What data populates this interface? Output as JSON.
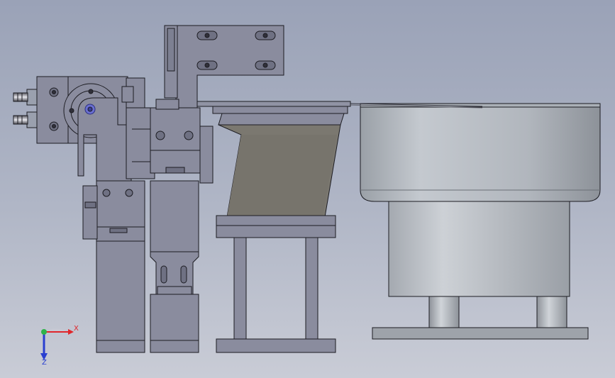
{
  "triad": {
    "x_label": "X",
    "z_label": "Z",
    "x_color": "#e0262b",
    "y_color": "#2fb34a",
    "z_color": "#2a3fd0"
  },
  "colors": {
    "background_top": "#9aa2b7",
    "background_bottom": "#c9ccd6",
    "steel": "#8a8c9e",
    "steel_dark": "#6f7183",
    "outline": "#1c1c22",
    "chute": "#7b7870",
    "bowl_light": "#b7bdc4",
    "bowl_dark": "#8f959c"
  }
}
